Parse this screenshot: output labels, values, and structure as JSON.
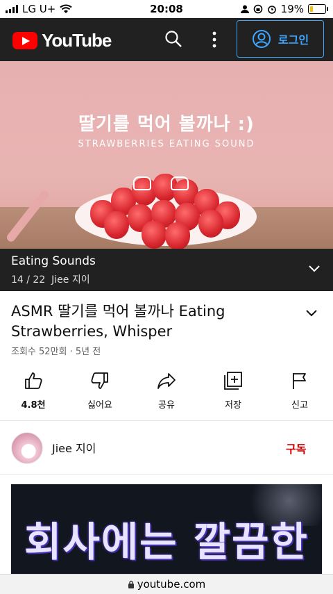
{
  "status_bar": {
    "carrier": "LG U+",
    "time": "20:08",
    "battery": "19%"
  },
  "header": {
    "brand": "YouTube",
    "login_label": "로그인"
  },
  "video": {
    "overlay_title": "딸기를 먹어 볼까나 :)",
    "overlay_subtitle": "STRAWBERRIES EATING SOUND"
  },
  "playlist": {
    "title": "Eating Sounds",
    "position": "14 / 22",
    "channel": "Jiee 지이"
  },
  "details": {
    "title": "ASMR 딸기를 먹어 볼까나 Eating Strawberries, Whisper",
    "meta": "조회수 52만회 · 5년 전"
  },
  "actions": [
    {
      "label": "4.8천",
      "icon": "thumbs-up-icon"
    },
    {
      "label": "싫어요",
      "icon": "thumbs-down-icon"
    },
    {
      "label": "공유",
      "icon": "share-icon"
    },
    {
      "label": "저장",
      "icon": "save-playlist-icon"
    },
    {
      "label": "신고",
      "icon": "flag-icon"
    }
  ],
  "channel": {
    "name": "Jiee 지이",
    "subscribe_label": "구독"
  },
  "next_card": {
    "text": "회사에는 깔끔한"
  },
  "url_bar": {
    "url": "youtube.com"
  }
}
